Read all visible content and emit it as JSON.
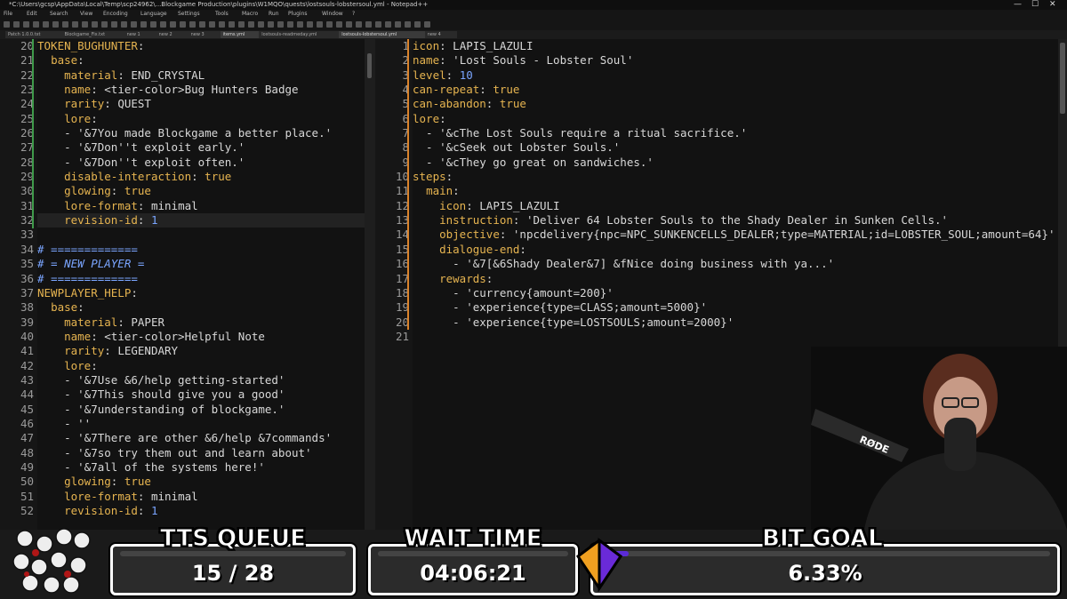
{
  "window": {
    "title": "*C:\\Users\\gcsp\\AppData\\Local\\Temp\\scp24962\\...Blockgame Production\\plugins\\W1MQO\\quests\\lostsouls-lobstersoul.yml - Notepad++",
    "controls": [
      "—",
      "☐",
      "✕"
    ]
  },
  "menu": [
    "File",
    "Edit",
    "Search",
    "View",
    "Encoding",
    "Language",
    "Settings",
    "Tools",
    "Macro",
    "Run",
    "Plugins",
    "Window",
    "?"
  ],
  "tabs": [
    {
      "label": "Patch 1.0.0.txt",
      "active": false
    },
    {
      "label": "Blockgame_Fix.txt",
      "active": false
    },
    {
      "label": "new 1",
      "active": false
    },
    {
      "label": "new 2",
      "active": false
    },
    {
      "label": "new 3",
      "active": false
    },
    {
      "label": "items.yml",
      "active": true
    },
    {
      "label": "lostsouls-readmeday.yml",
      "active": false
    },
    {
      "label": "lostsouls-lobstersoul.yml",
      "active": true
    },
    {
      "label": "new 4",
      "active": false
    }
  ],
  "left_editor": {
    "lines": [
      {
        "n": "20",
        "text": "TOKEN_BUGHUNTER:"
      },
      {
        "n": "21",
        "text": "  base:"
      },
      {
        "n": "22",
        "text": "    material: END_CRYSTAL"
      },
      {
        "n": "23",
        "text": "    name: <tier-color>Bug Hunters Badge"
      },
      {
        "n": "24",
        "text": "    rarity: QUEST"
      },
      {
        "n": "25",
        "text": "    lore:"
      },
      {
        "n": "26",
        "text": "    - '&7You made Blockgame a better place.'"
      },
      {
        "n": "27",
        "text": "    - '&7Don''t exploit early.'"
      },
      {
        "n": "28",
        "text": "    - '&7Don''t exploit often.'"
      },
      {
        "n": "29",
        "text": "    disable-interaction: true"
      },
      {
        "n": "30",
        "text": "    glowing: true"
      },
      {
        "n": "31",
        "text": "    lore-format: minimal"
      },
      {
        "n": "32",
        "text": "    revision-id: 1"
      },
      {
        "n": "33",
        "text": ""
      },
      {
        "n": "34",
        "text": "# ============="
      },
      {
        "n": "35",
        "text": "# = NEW PLAYER ="
      },
      {
        "n": "36",
        "text": "# ============="
      },
      {
        "n": "37",
        "text": "NEWPLAYER_HELP:"
      },
      {
        "n": "38",
        "text": "  base:"
      },
      {
        "n": "39",
        "text": "    material: PAPER"
      },
      {
        "n": "40",
        "text": "    name: <tier-color>Helpful Note"
      },
      {
        "n": "41",
        "text": "    rarity: LEGENDARY"
      },
      {
        "n": "42",
        "text": "    lore:"
      },
      {
        "n": "43",
        "text": "    - '&7Use &6/help getting-started'"
      },
      {
        "n": "44",
        "text": "    - '&7This should give you a good'"
      },
      {
        "n": "45",
        "text": "    - '&7understanding of blockgame.'"
      },
      {
        "n": "46",
        "text": "    - ''"
      },
      {
        "n": "47",
        "text": "    - '&7There are other &6/help &7commands'"
      },
      {
        "n": "48",
        "text": "    - '&7so try them out and learn about'"
      },
      {
        "n": "49",
        "text": "    - '&7all of the systems here!'"
      },
      {
        "n": "50",
        "text": "    glowing: true"
      },
      {
        "n": "51",
        "text": "    lore-format: minimal"
      },
      {
        "n": "52",
        "text": "    revision-id: 1"
      }
    ]
  },
  "right_editor": {
    "lines": [
      {
        "n": "1",
        "text": "icon: LAPIS_LAZULI"
      },
      {
        "n": "2",
        "text": "name: 'Lost Souls - Lobster Soul'"
      },
      {
        "n": "3",
        "text": "level: 10"
      },
      {
        "n": "4",
        "text": "can-repeat: true"
      },
      {
        "n": "5",
        "text": "can-abandon: true"
      },
      {
        "n": "6",
        "text": "lore:"
      },
      {
        "n": "7",
        "text": "  - '&cThe Lost Souls require a ritual sacrifice.'"
      },
      {
        "n": "8",
        "text": "  - '&cSeek out Lobster Souls.'"
      },
      {
        "n": "9",
        "text": "  - '&cThey go great on sandwiches.'"
      },
      {
        "n": "10",
        "text": "steps:"
      },
      {
        "n": "11",
        "text": "  main:"
      },
      {
        "n": "12",
        "text": "    icon: LAPIS_LAZULI"
      },
      {
        "n": "13",
        "text": "    instruction: 'Deliver 64 Lobster Souls to the Shady Dealer in Sunken Cells.'"
      },
      {
        "n": "14",
        "text": "    objective: 'npcdelivery{npc=NPC_SUNKENCELLS_DEALER;type=MATERIAL;id=LOBSTER_SOUL;amount=64}'"
      },
      {
        "n": "15",
        "text": "    dialogue-end:"
      },
      {
        "n": "16",
        "text": "      - '&7[&6Shady Dealer&7] &fNice doing business with ya...'"
      },
      {
        "n": "17",
        "text": "    rewards:"
      },
      {
        "n": "18",
        "text": "      - 'currency{amount=200}'"
      },
      {
        "n": "19",
        "text": "      - 'experience{type=CLASS;amount=5000}'"
      },
      {
        "n": "20",
        "text": "      - 'experience{type=LOSTSOULS;amount=2000}'"
      },
      {
        "n": "21",
        "text": ""
      }
    ]
  },
  "overlay": {
    "tts": {
      "label": "TTS QUEUE",
      "value": "15 / 28"
    },
    "wait": {
      "label": "WAIT TIME",
      "value": "04:06:21"
    },
    "bit": {
      "label": "BIT GOAL",
      "value": "6.33%",
      "progress_pct": 6.33
    },
    "mic_brand": "RØDE"
  },
  "colors": {
    "key": "#e6b450",
    "value": "#d8d8d8",
    "accent": "#7aa5ff",
    "bg": "#121212",
    "bit_progress": "#5b2bd6"
  }
}
